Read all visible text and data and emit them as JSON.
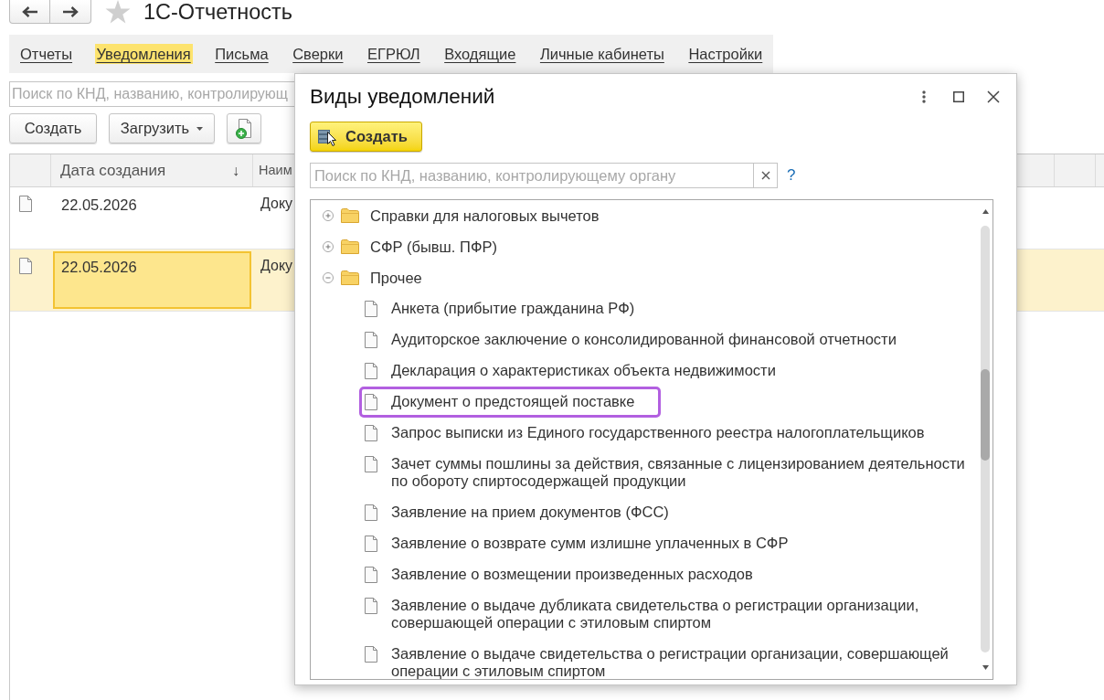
{
  "title": "1С-Отчетность",
  "favorite": false,
  "tabs": [
    {
      "label": "Отчеты",
      "selected": false
    },
    {
      "label": "Уведомления",
      "selected": true
    },
    {
      "label": "Письма",
      "selected": false
    },
    {
      "label": "Сверки",
      "selected": false
    },
    {
      "label": "ЕГРЮЛ",
      "selected": false
    },
    {
      "label": "Входящие",
      "selected": false
    },
    {
      "label": "Личные кабинеты",
      "selected": false
    },
    {
      "label": "Настройки",
      "selected": false
    }
  ],
  "search": {
    "placeholder": "Поиск по КНД, названию, контролирующ"
  },
  "toolbar": [
    {
      "kind": "text",
      "label": "Создать"
    },
    {
      "kind": "dropdown",
      "label": "Загрузить"
    },
    {
      "kind": "icon"
    }
  ],
  "table": {
    "columns": [
      {
        "label": "Дата создания",
        "sort_mark": "↓"
      },
      {
        "label": "Наим"
      }
    ],
    "rows": [
      {
        "date": "22.05.2026",
        "column_2": "Доку",
        "selected": false
      },
      {
        "date": "22.05.2026",
        "column_2": "Доку",
        "selected": true
      }
    ]
  },
  "dialog": {
    "title": "Виды уведомлений",
    "create_button": "Создать",
    "search": {
      "placeholder": "Поиск по КНД, названию, контролирующему органу"
    },
    "help_link": "?",
    "tree": [
      {
        "label": "Справки для налоговых вычетов",
        "expanded": false
      },
      {
        "label": "СФР (бывш. ПФР)",
        "expanded": false
      },
      {
        "label": "Прочее",
        "expanded": true,
        "children": [
          {
            "label": "Анкета (прибытие гражданина РФ)",
            "highlighted": false
          },
          {
            "label": "Аудиторское заключение о консолидированной финансовой отчетности",
            "highlighted": false
          },
          {
            "label": "Декларация о характеристиках объекта недвижимости",
            "highlighted": false
          },
          {
            "label": "Документ о предстоящей поставке",
            "highlighted": true
          },
          {
            "label": "Запрос выписки из Единого государственного реестра налогоплательщиков",
            "highlighted": false
          },
          {
            "label": "Зачет суммы пошлины за действия, связанные с лицензированием деятельности по обороту спиртосодержащей продукции",
            "highlighted": false
          },
          {
            "label": "Заявление на прием документов (ФСС)",
            "highlighted": false
          },
          {
            "label": "Заявление о возврате сумм излишне уплаченных в СФР",
            "highlighted": false
          },
          {
            "label": "Заявление о возмещении произведенных расходов",
            "highlighted": false
          },
          {
            "label": "Заявление о выдаче дубликата свидетельства о регистрации организации, совершающей операции с этиловым спиртом",
            "highlighted": false
          },
          {
            "label": "Заявление о выдаче свидетельства о регистрации организации, совершающей операции с этиловым спиртом",
            "highlighted": false
          }
        ]
      }
    ]
  }
}
